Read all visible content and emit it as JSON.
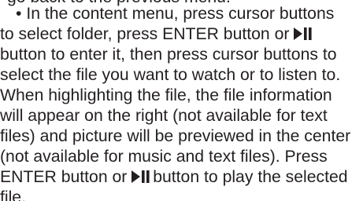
{
  "document": {
    "partial_top_line": "go back to the previous menu.",
    "bullet": "•",
    "lines": [
      "In the content menu, press cursor buttons",
      "to select folder, press ENTER button or",
      "button to enter it, then press cursor buttons to",
      "select the file you want to watch or to listen to.",
      "When highlighting the file, the file information",
      "will appear on the right (not available for text",
      "files) and picture will be previewed in the center",
      "(not available for music and text files). Press",
      "ENTER button or",
      "button to play the selected",
      "file."
    ],
    "icon": "play-pause-icon"
  }
}
